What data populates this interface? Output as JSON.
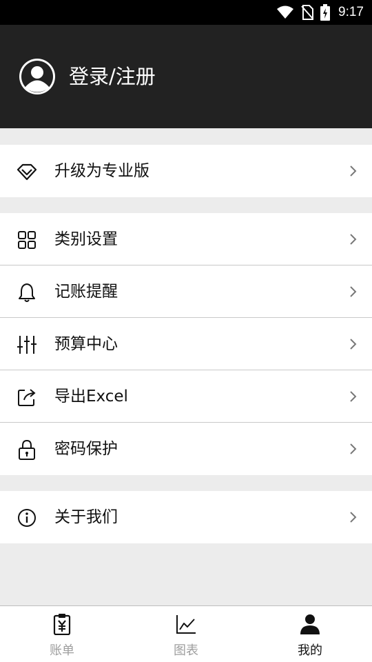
{
  "status_bar": {
    "time": "9:17",
    "icons": [
      "wifi-icon",
      "no-sim-icon",
      "battery-charging-icon"
    ]
  },
  "header": {
    "login_label": "登录/注册",
    "avatar_icon": "user-circle-icon"
  },
  "groups": [
    {
      "items": [
        {
          "label": "升级为专业版",
          "icon": "diamond-icon"
        }
      ]
    },
    {
      "items": [
        {
          "label": "类别设置",
          "icon": "category-grid-icon"
        },
        {
          "label": "记账提醒",
          "icon": "bell-icon"
        },
        {
          "label": "预算中心",
          "icon": "sliders-icon"
        },
        {
          "label": "导出Excel",
          "icon": "export-icon"
        },
        {
          "label": "密码保护",
          "icon": "lock-icon"
        }
      ]
    },
    {
      "items": [
        {
          "label": "关于我们",
          "icon": "info-icon"
        }
      ]
    }
  ],
  "tabs": [
    {
      "label": "账单",
      "icon": "bill-clipboard-icon",
      "active": false
    },
    {
      "label": "图表",
      "icon": "line-chart-icon",
      "active": false
    },
    {
      "label": "我的",
      "icon": "person-icon",
      "active": true
    }
  ],
  "colors": {
    "header_bg": "#222222",
    "page_bg": "#ececec",
    "inactive_tab": "#9e9e9e",
    "active_tab": "#111111"
  }
}
